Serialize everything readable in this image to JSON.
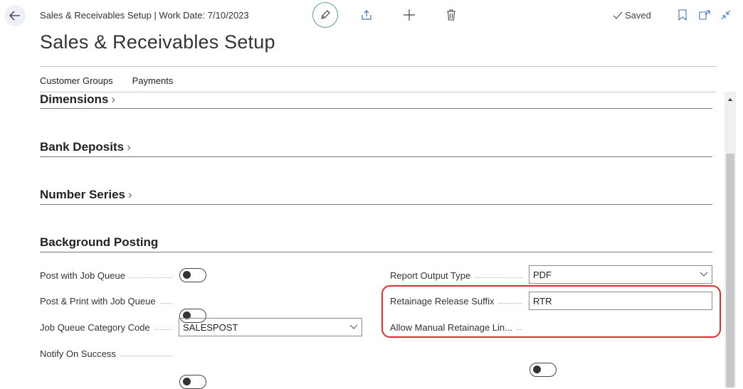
{
  "header": {
    "breadcrumb": "Sales & Receivables Setup | Work Date: 7/10/2023",
    "title": "Sales & Receivables Setup",
    "saved_label": "Saved"
  },
  "actions": [
    "Customer Groups",
    "Payments"
  ],
  "sections": {
    "dimensions": "Dimensions",
    "bank_deposits": "Bank Deposits",
    "number_series": "Number Series",
    "background_posting": "Background Posting"
  },
  "fields": {
    "post_with_job_queue": {
      "label": "Post with Job Queue",
      "value": false
    },
    "post_print_job_queue": {
      "label": "Post & Print with Job Queue",
      "value": false
    },
    "job_queue_category_code": {
      "label": "Job Queue Category Code",
      "value": "SALESPOST"
    },
    "notify_on_success": {
      "label": "Notify On Success",
      "value": false
    },
    "report_output_type": {
      "label": "Report Output Type",
      "value": "PDF"
    },
    "retainage_release_suffix": {
      "label": "Retainage Release Suffix",
      "value": "RTR"
    },
    "allow_manual_retainage": {
      "label": "Allow Manual Retainage Lin...",
      "value": false
    }
  },
  "colors": {
    "highlight": "#e02b2b",
    "edit_ring": "#5b9aa0"
  }
}
